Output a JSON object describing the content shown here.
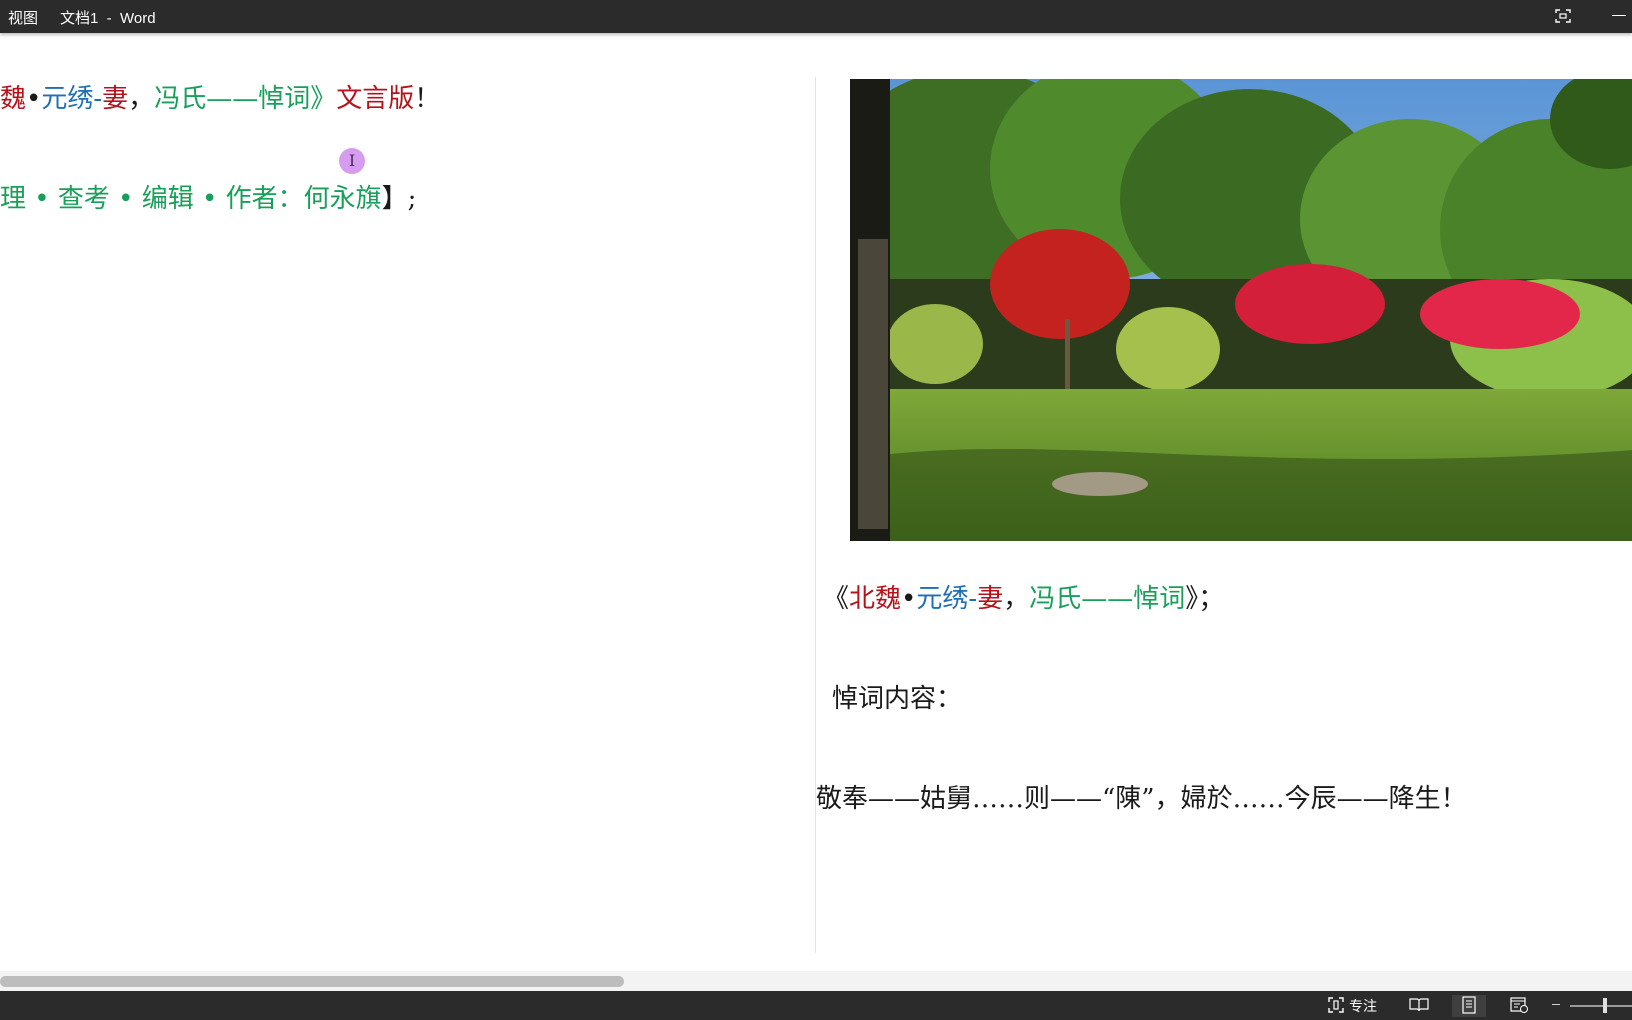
{
  "titlebar": {
    "menu_view": "视图",
    "document_title": "文档1  -  Word"
  },
  "left_page": {
    "line1": [
      {
        "text": "魏",
        "color": "red"
      },
      {
        "text": "•",
        "color": "black"
      },
      {
        "text": "元绣",
        "color": "blue"
      },
      {
        "text": "-",
        "color": "blue"
      },
      {
        "text": "妻",
        "color": "red"
      },
      {
        "text": "，",
        "color": "black"
      },
      {
        "text": "冯氏——悼词》",
        "color": "green"
      },
      {
        "text": "文言版",
        "color": "red"
      },
      {
        "text": "！",
        "color": "black"
      }
    ],
    "line2": [
      {
        "text": "理 • 查考 • 编辑 • 作者：何永旗",
        "color": "green"
      },
      {
        "text": "】",
        "color": "black"
      },
      {
        "text": ";",
        "color": "black"
      }
    ],
    "cursor_glyph": "I"
  },
  "right_page": {
    "title_line": [
      {
        "text": "《",
        "color": "black"
      },
      {
        "text": "北魏",
        "color": "red"
      },
      {
        "text": "•",
        "color": "black"
      },
      {
        "text": "元绣",
        "color": "blue"
      },
      {
        "text": "-",
        "color": "blue"
      },
      {
        "text": "妻",
        "color": "red"
      },
      {
        "text": "，",
        "color": "black"
      },
      {
        "text": "冯氏——悼词",
        "color": "green"
      },
      {
        "text": "》",
        "color": "black"
      },
      {
        "text": "；",
        "color": "black"
      }
    ],
    "heading": "悼词内容：",
    "body": "敬奉——姑舅……则——“陳”，婦於……今辰——降生！",
    "image_subject": "garden-photo"
  },
  "statusbar": {
    "focus_label": "专注",
    "zoom_slider_level": 0.5
  },
  "scrollbar": {
    "horizontal_thumb_fraction": 0.38
  },
  "colors": {
    "red": "#b5121b",
    "blue": "#1f6fb4",
    "green": "#18a05a",
    "black": "#1a1a1a",
    "chrome": "#2b2b2b"
  },
  "icons": {
    "focus": "focus-mode-icon",
    "read_mode": "read-mode-icon",
    "print_layout": "print-layout-icon",
    "web_layout": "web-layout-icon",
    "window_focus": "window-focus-icon",
    "minimize": "minimize-icon"
  }
}
